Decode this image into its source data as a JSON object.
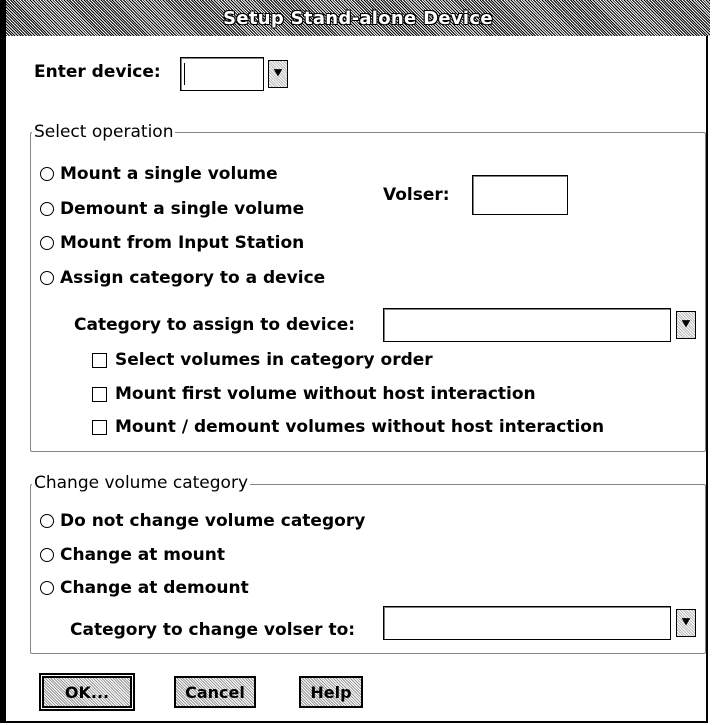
{
  "window": {
    "title": "Setup Stand-alone Device"
  },
  "device": {
    "label": "Enter device:",
    "value": "",
    "dropdown_icon": "down-arrow-icon"
  },
  "select_operation": {
    "group_label": "Select operation",
    "options": [
      "Mount a single volume",
      "Demount a single volume",
      "Mount from Input Station",
      "Assign category to a device"
    ],
    "volser_label": "Volser:",
    "volser_value": "",
    "category_label": "Category to assign to device:",
    "category_value": "",
    "checkboxes": [
      "Select volumes in category order",
      "Mount first volume without host interaction",
      "Mount / demount volumes without host interaction"
    ]
  },
  "change_category": {
    "group_label": "Change volume category",
    "options": [
      "Do not change volume category",
      "Change at mount",
      "Change at demount"
    ],
    "category_label": "Category to change volser to:",
    "category_value": ""
  },
  "buttons": {
    "ok": "OK...",
    "cancel": "Cancel",
    "help": "Help"
  }
}
